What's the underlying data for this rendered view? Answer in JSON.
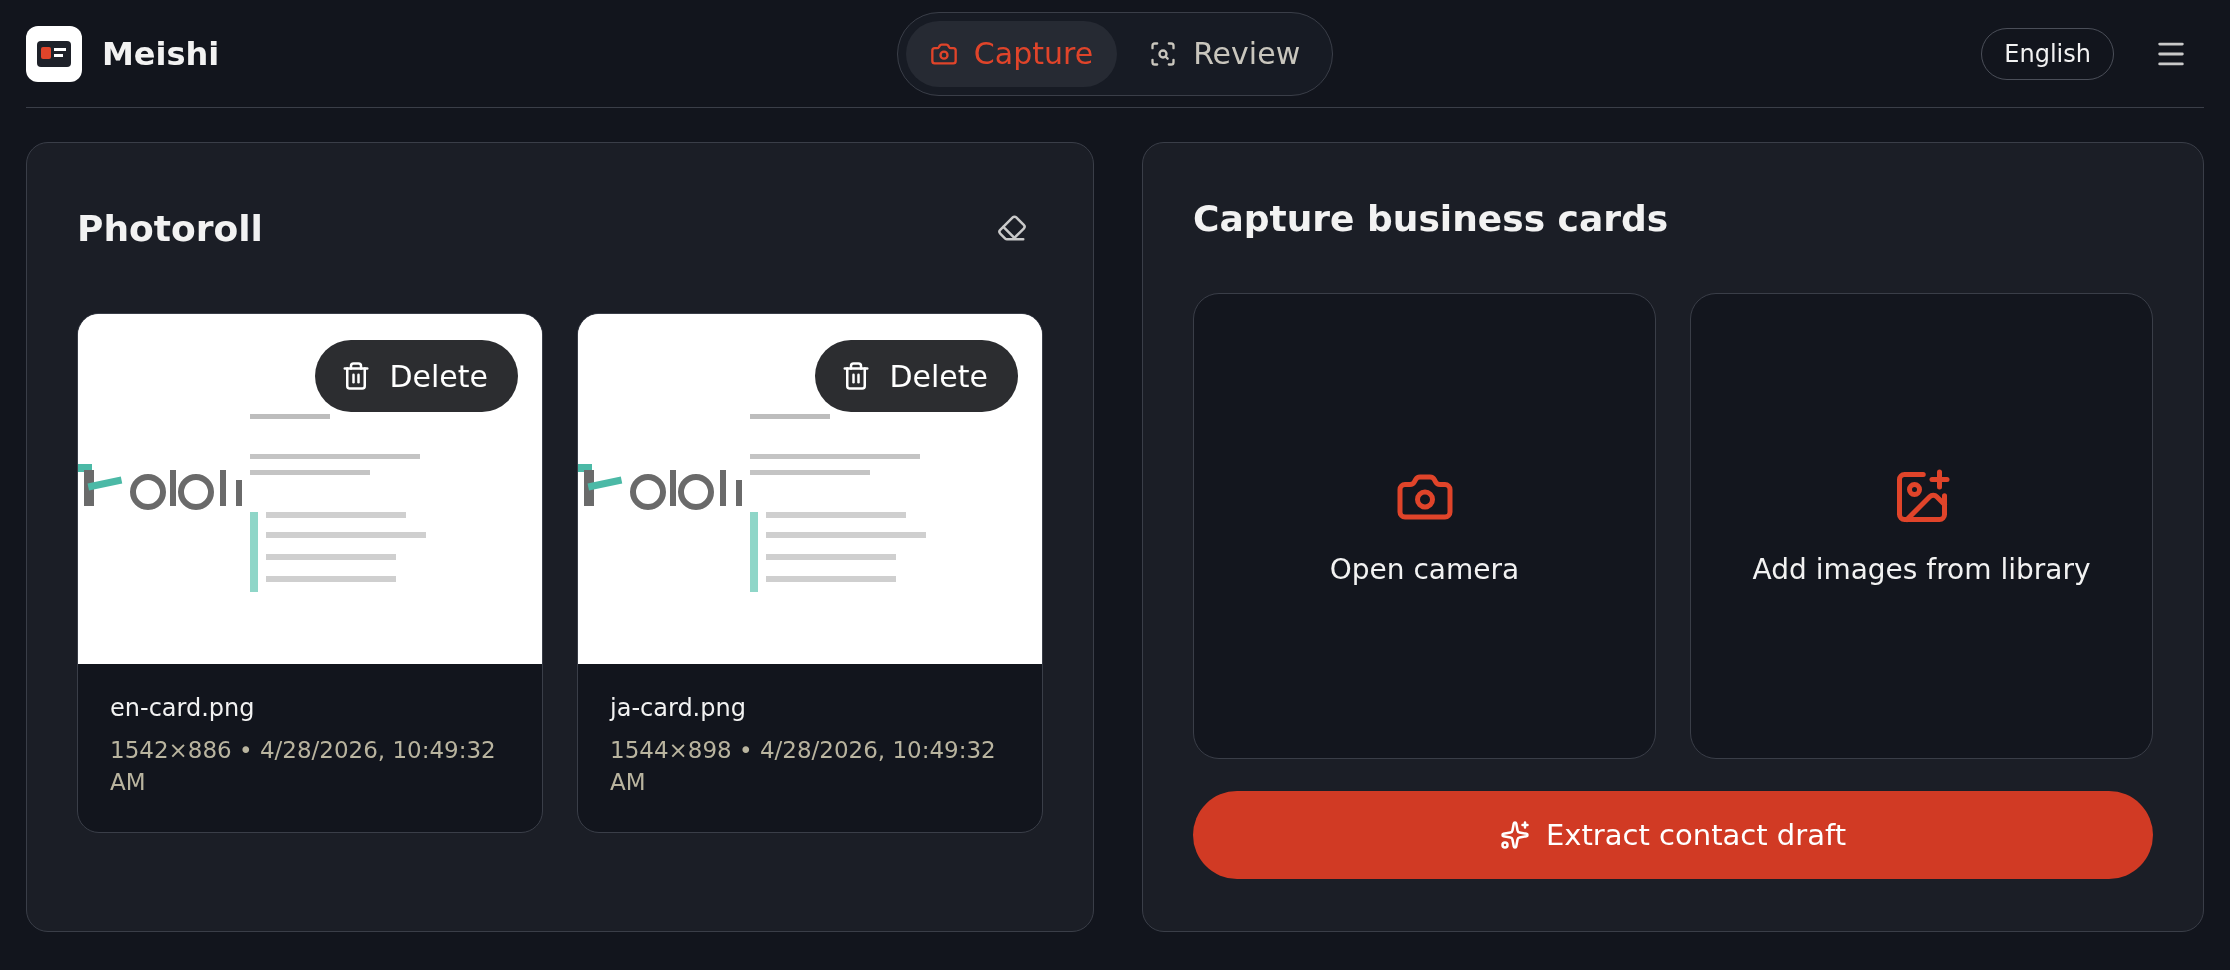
{
  "app": {
    "name": "Meishi"
  },
  "tabs": [
    {
      "label": "Capture",
      "kind": "camera",
      "selected": true
    },
    {
      "label": "Review",
      "kind": "scan",
      "selected": false
    }
  ],
  "language_button": "English",
  "photoroll": {
    "title": "Photoroll",
    "items": [
      {
        "kind": "picture",
        "delete_label": "Delete",
        "filename": "en-card.png",
        "meta": "1542×886 • 4/28/2026, 10:49:32 AM"
      },
      {
        "kind": "picture",
        "delete_label": "Delete",
        "filename": "ja-card.png",
        "meta": "1544×898 • 4/28/2026, 10:49:32 AM"
      }
    ]
  },
  "capture": {
    "title": "Capture business cards",
    "sources": [
      {
        "kind": "camera",
        "label": "Open camera"
      },
      {
        "kind": "library",
        "label": "Add images from library"
      }
    ],
    "extract_button": "Extract contact draft"
  }
}
